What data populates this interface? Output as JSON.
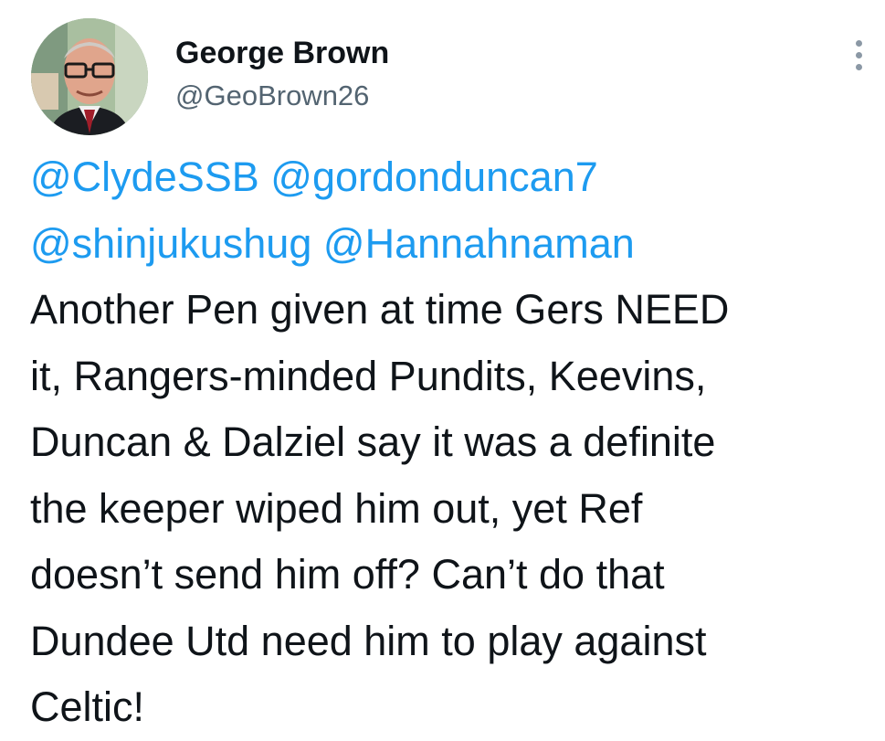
{
  "author": {
    "display_name": "George Brown",
    "handle": "@GeoBrown26"
  },
  "icons": {
    "more": "more-vertical-icon",
    "avatar": "avatar"
  },
  "colors": {
    "mention": "#1d9bf0",
    "text": "#0f1419",
    "secondary": "#536471"
  },
  "tweet": {
    "mentions": [
      "@ClydeSSB",
      "@gordonduncan7",
      "@shinjukushug",
      "@Hannahnaman"
    ],
    "text_lines": [
      "Another Pen given at time Gers NEED",
      "it, Rangers-minded Pundits, Keevins,",
      "Duncan & Dalziel say it was a definite",
      "the keeper wiped him out, yet Ref",
      "doesn’t send him off?  Can’t do that",
      "Dundee Utd need him to play against",
      "Celtic!"
    ]
  }
}
